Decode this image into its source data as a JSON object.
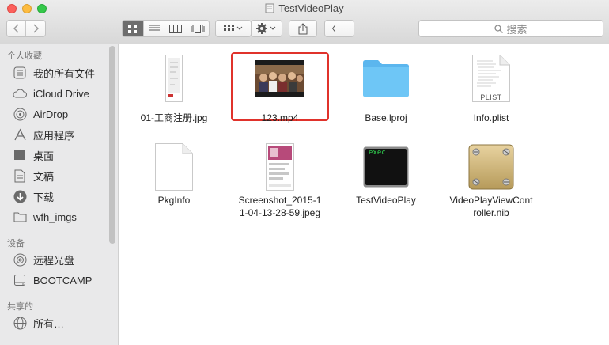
{
  "window": {
    "title": "TestVideoPlay"
  },
  "toolbar": {
    "back": "chevron-left-icon",
    "forward": "chevron-right-icon",
    "search_placeholder": "搜索"
  },
  "sidebar": {
    "sections": [
      {
        "title": "个人收藏",
        "items": [
          "我的所有文件",
          "iCloud Drive",
          "AirDrop",
          "应用程序",
          "桌面",
          "文稿",
          "下载",
          "wfh_imgs"
        ]
      },
      {
        "title": "设备",
        "items": [
          "远程光盘",
          "BOOTCAMP"
        ]
      },
      {
        "title": "共享的",
        "items": [
          "所有…"
        ]
      }
    ]
  },
  "files": [
    {
      "name": "01-工商注册.jpg",
      "type": "image-doc"
    },
    {
      "name": "123.mp4",
      "type": "video",
      "selected": true
    },
    {
      "name": "Base.lproj",
      "type": "folder"
    },
    {
      "name": "Info.plist",
      "type": "plist",
      "badge": "PLIST"
    },
    {
      "name": "PkgInfo",
      "type": "blank"
    },
    {
      "name": "Screenshot_2015-1\n1-04-13-28-59.jpeg",
      "name_line1": "Screenshot_2015-1",
      "name_line2": "1-04-13-28-59.jpeg",
      "type": "screenshot"
    },
    {
      "name": "TestVideoPlay",
      "type": "exec",
      "badge": "exec"
    },
    {
      "name_line1": "VideoPlayViewCont",
      "name_line2": "roller.nib",
      "type": "nib"
    }
  ],
  "colors": {
    "selection_outline": "#e0322b",
    "folder": "#5fbef4",
    "accent": "#6d6d6d"
  }
}
